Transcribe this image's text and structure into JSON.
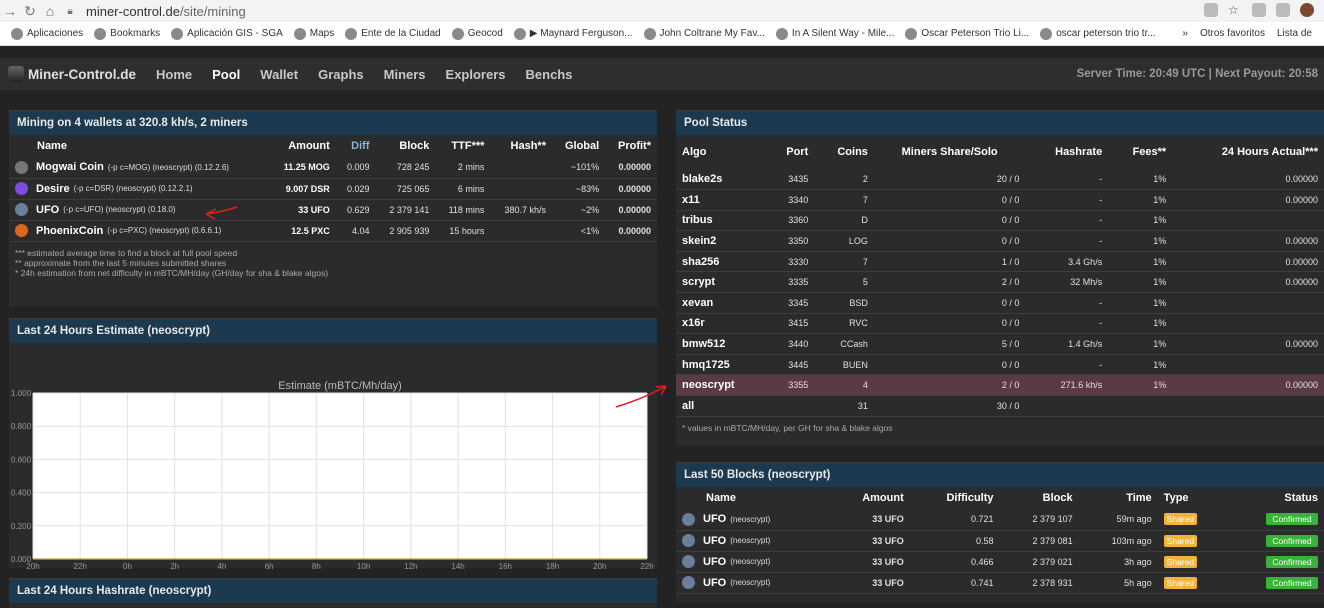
{
  "browser": {
    "url_host": "miner-control.de",
    "url_path": "/site/mining",
    "bookmarks": [
      "Aplicaciones",
      "Bookmarks",
      "Aplicación GIS - SGA",
      "Maps",
      "Ente de la Ciudad",
      "Geocod",
      "▶ Maynard Ferguson...",
      "John Coltrane My Fav...",
      "In A Silent Way - Mile...",
      "Oscar Peterson Trio Li...",
      "oscar peterson trio tr..."
    ],
    "bookmarks_right": [
      "»",
      "Otros favoritos",
      "Lista de"
    ]
  },
  "nav": {
    "logo": "Miner-Control.de",
    "links": [
      "Home",
      "Pool",
      "Wallet",
      "Graphs",
      "Miners",
      "Explorers",
      "Benchs"
    ],
    "active": "Pool",
    "server_info": "Server Time: 20:49 UTC | Next Payout: 20:58"
  },
  "mining": {
    "title": "Mining on 4 wallets at 320.8 kh/s, 2 miners",
    "headers": [
      "Name",
      "Amount",
      "Diff",
      "Block",
      "TTF***",
      "Hash**",
      "Global",
      "Profit*"
    ],
    "rows": [
      {
        "name": "Mogwai Coin",
        "tag": "(-p c=MOG) (neoscrypt) (0.12.2.6)",
        "amount": "11.25 MOG",
        "diff": "0.009",
        "block": "728 245",
        "ttf": "2 mins",
        "hash": "",
        "global": "~101%",
        "profit": "0.00000",
        "color": "#777777"
      },
      {
        "name": "Desire",
        "tag": "(-p c=DSR) (neoscrypt) (0.12.2.1)",
        "amount": "9.007 DSR",
        "diff": "0.029",
        "block": "725 065",
        "ttf": "6 mins",
        "hash": "",
        "global": "~83%",
        "profit": "0.00000",
        "color": "#7a4de0"
      },
      {
        "name": "UFO",
        "tag": "(-p c=UFO) (neoscrypt) (0.18.0)",
        "amount": "33 UFO",
        "diff": "0.629",
        "block": "2 379 141",
        "ttf": "118 mins",
        "hash": "380.7 kh/s",
        "global": "~2%",
        "profit": "0.00000",
        "color": "#6a7f99"
      },
      {
        "name": "PhoenixCoin",
        "tag": "(-p c=PXC) (neoscrypt) (0.6.6.1)",
        "amount": "12.5 PXC",
        "diff": "4.04",
        "block": "2 905 939",
        "ttf": "15 hours",
        "hash": "",
        "global": "<1%",
        "profit": "0.00000",
        "color": "#e0661e"
      }
    ],
    "notes": [
      "*** estimated average time to find a block at full pool speed",
      "** approximate from the last 5 minutes submitted shares",
      "* 24h estimation from net difficulty in mBTC/MH/day (GH/day for sha & blake algos)"
    ]
  },
  "estimate": {
    "title": "Last 24 Hours Estimate (neoscrypt)"
  },
  "hashrate": {
    "title": "Last 24 Hours Hashrate (neoscrypt)"
  },
  "chart_data": {
    "type": "line",
    "title": "Estimate (mBTC/Mh/day)",
    "x": [
      "20h",
      "22h",
      "0h",
      "2h",
      "4h",
      "6h",
      "8h",
      "10h",
      "12h",
      "14h",
      "16h",
      "18h",
      "20h",
      "22h"
    ],
    "series": [],
    "ylim": [
      0,
      1
    ],
    "yticks": [
      "0.000",
      "0.200",
      "0.400",
      "0.600",
      "0.800",
      "1.000"
    ],
    "grid": true
  },
  "pool": {
    "title": "Pool Status",
    "headers": [
      "Algo",
      "Port",
      "Coins",
      "Miners Share/Solo",
      "Hashrate",
      "Fees**",
      "24 Hours Actual***"
    ],
    "rows": [
      {
        "algo": "blake2s",
        "port": "3435",
        "coins": "2",
        "miners": "20 / 0",
        "hashrate": "-",
        "fees": "1%",
        "actual": "0.00000"
      },
      {
        "algo": "x11",
        "port": "3340",
        "coins": "7",
        "miners": "0 / 0",
        "hashrate": "-",
        "fees": "1%",
        "actual": "0.00000"
      },
      {
        "algo": "tribus",
        "port": "3360",
        "coins": "D",
        "miners": "0 / 0",
        "hashrate": "-",
        "fees": "1%",
        "actual": ""
      },
      {
        "algo": "skein2",
        "port": "3350",
        "coins": "LOG",
        "miners": "0 / 0",
        "hashrate": "-",
        "fees": "1%",
        "actual": "0.00000"
      },
      {
        "algo": "sha256",
        "port": "3330",
        "coins": "7",
        "miners": "1 / 0",
        "hashrate": "3.4 Gh/s",
        "fees": "1%",
        "actual": "0.00000"
      },
      {
        "algo": "scrypt",
        "port": "3335",
        "coins": "5",
        "miners": "2 / 0",
        "hashrate": "32 Mh/s",
        "fees": "1%",
        "actual": "0.00000"
      },
      {
        "algo": "xevan",
        "port": "3345",
        "coins": "BSD",
        "miners": "0 / 0",
        "hashrate": "-",
        "fees": "1%",
        "actual": ""
      },
      {
        "algo": "x16r",
        "port": "3415",
        "coins": "RVC",
        "miners": "0 / 0",
        "hashrate": "-",
        "fees": "1%",
        "actual": ""
      },
      {
        "algo": "bmw512",
        "port": "3440",
        "coins": "CCash",
        "miners": "5 / 0",
        "hashrate": "1.4 Gh/s",
        "fees": "1%",
        "actual": "0.00000"
      },
      {
        "algo": "hmq1725",
        "port": "3445",
        "coins": "BUEN",
        "miners": "0 / 0",
        "hashrate": "-",
        "fees": "1%",
        "actual": ""
      },
      {
        "algo": "neoscrypt",
        "port": "3355",
        "coins": "4",
        "miners": "2 / 0",
        "hashrate": "271.6 kh/s",
        "fees": "1%",
        "actual": "0.00000"
      },
      {
        "algo": "all",
        "port": "",
        "coins": "31",
        "miners": "30 / 0",
        "hashrate": "",
        "fees": "",
        "actual": ""
      }
    ],
    "note": "* values in mBTC/MH/day, per GH for sha & blake algos"
  },
  "blocks": {
    "title": "Last 50 Blocks (neoscrypt)",
    "headers": [
      "Name",
      "Amount",
      "Difficulty",
      "Block",
      "Time",
      "Type",
      "Status"
    ],
    "rows": [
      {
        "name": "UFO",
        "tag": "(neoscrypt)",
        "amount": "33 UFO",
        "difficulty": "0.721",
        "block": "2 379 107",
        "time": "59m ago",
        "type": "Shared",
        "status": "Confirmed"
      },
      {
        "name": "UFO",
        "tag": "(neoscrypt)",
        "amount": "33 UFO",
        "difficulty": "0.58",
        "block": "2 379 081",
        "time": "103m ago",
        "type": "Shared",
        "status": "Confirmed"
      },
      {
        "name": "UFO",
        "tag": "(neoscrypt)",
        "amount": "33 UFO",
        "difficulty": "0.466",
        "block": "2 379 021",
        "time": "3h ago",
        "type": "Shared",
        "status": "Confirmed"
      },
      {
        "name": "UFO",
        "tag": "(neoscrypt)",
        "amount": "33 UFO",
        "difficulty": "0.741",
        "block": "2 378 931",
        "time": "5h ago",
        "type": "Shared",
        "status": "Confirmed"
      }
    ]
  },
  "colors": {
    "panel_header": "#1c3a4f",
    "highlight_row": "#5a3a45",
    "shared": "#f0b43c",
    "confirmed": "#38b238",
    "annotation": "#e02020"
  }
}
